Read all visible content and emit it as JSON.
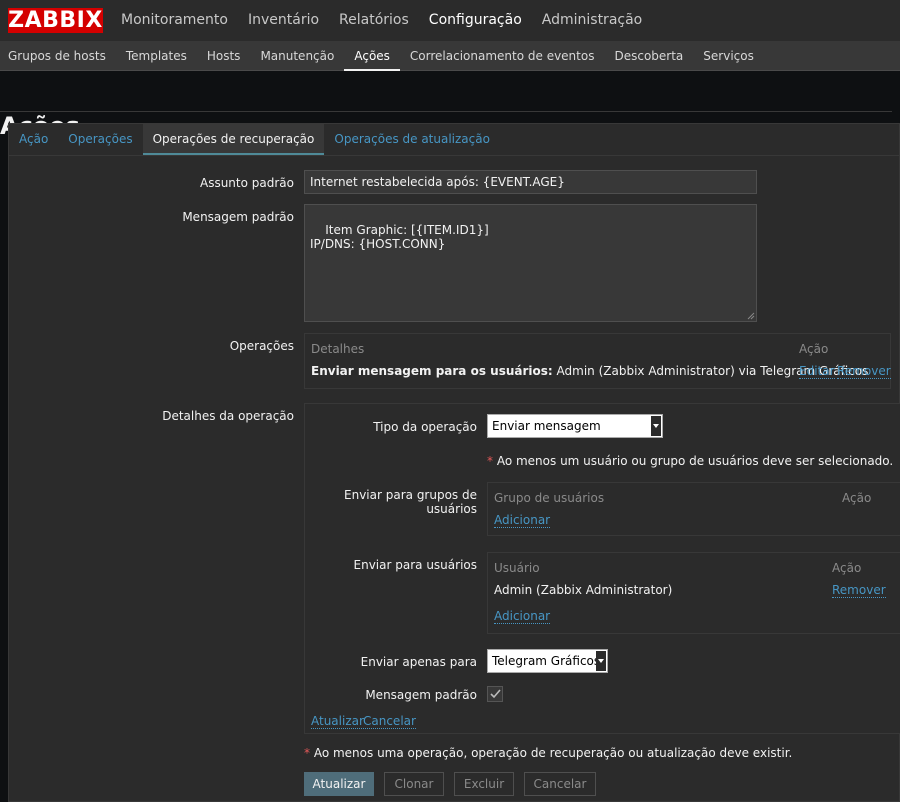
{
  "brand": "ZABBIX",
  "topmenu": [
    "Monitoramento",
    "Inventário",
    "Relatórios",
    "Configuração",
    "Administração"
  ],
  "submenu": [
    "Grupos de hosts",
    "Templates",
    "Hosts",
    "Manutenção",
    "Ações",
    "Correlacionamento de eventos",
    "Descoberta",
    "Serviços"
  ],
  "page_title": "Ações",
  "tabs": [
    "Ação",
    "Operações",
    "Operações de recuperação",
    "Operações de atualização"
  ],
  "form": {
    "subject_label": "Assunto padrão",
    "subject_value": "Internet restabelecida após: {EVENT.AGE}",
    "message_label": "Mensagem padrão",
    "message_value": "Item Graphic: [{ITEM.ID1}]\nIP/DNS: {HOST.CONN}",
    "operations_label": "Operações",
    "operations_header_details": "Detalhes",
    "operations_header_action": "Ação",
    "operation_row_bold": "Enviar mensagem para os usuários:",
    "operation_row_text": " Admin (Zabbix Administrator) via Telegram Gráficos",
    "operation_row_edit": "Editar",
    "operation_row_remove": "Remover",
    "details_label": "Detalhes da operação"
  },
  "details": {
    "type_label": "Tipo da operação",
    "type_value": "Enviar mensagem",
    "required_note": "Ao menos um usuário ou grupo de usuários deve ser selecionado.",
    "groups_label": "Enviar para grupos de usuários",
    "groups_header_group": "Grupo de usuários",
    "groups_header_action": "Ação",
    "groups_add": "Adicionar",
    "users_label": "Enviar para usuários",
    "users_header_user": "Usuário",
    "users_header_action": "Ação",
    "users_row_name": "Admin (Zabbix Administrator)",
    "users_row_remove": "Remover",
    "users_add": "Adicionar",
    "send_only_label": "Enviar apenas para",
    "send_only_value": "Telegram Gráficos",
    "default_msg_label": "Mensagem padrão",
    "default_msg_checked": true,
    "update_link": "Atualizar",
    "cancel_link": "Cancelar"
  },
  "footer_note": "Ao menos uma operação, operação de recuperação ou atualização deve existir.",
  "required_mark": "*",
  "buttons": {
    "update": "Atualizar",
    "clone": "Clonar",
    "delete": "Excluir",
    "cancel": "Cancelar"
  }
}
